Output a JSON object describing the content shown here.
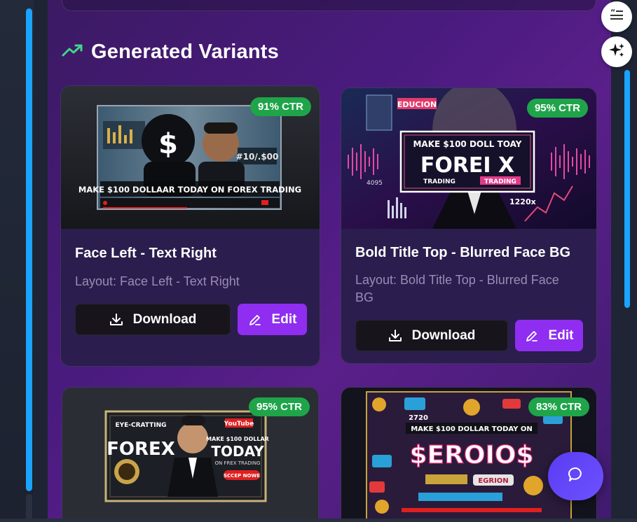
{
  "section": {
    "title": "Generated Variants",
    "icon": "trending-up-icon"
  },
  "cards": [
    {
      "ctr": "91% CTR",
      "title": "Face Left - Text Right",
      "layout": "Layout: Face Left - Text Right",
      "download_label": "Download",
      "edit_label": "Edit",
      "thumb_text": "MAKE $100 DOLLAAR TODAY ON FOREX TRADING",
      "thumb_small": "#10/.$00"
    },
    {
      "ctr": "95% CTR",
      "title": "Bold Title Top - Blurred Face BG",
      "layout_line1": "Layout: Bold Title Top - Blurred Face",
      "layout_line2": "BG",
      "download_label": "Download",
      "edit_label": "Edit",
      "thumb_badge": "EDUCION",
      "thumb_line1": "MAKE $100 DOLL TOAY",
      "thumb_main": "FOREI X",
      "thumb_sub": "TRADING",
      "thumb_sub2": "TRADING",
      "thumb_num1": "1220x",
      "thumb_num2": "4095"
    },
    {
      "ctr": "95% CTR",
      "thumb_top": "EYE-CRATTING",
      "thumb_yt": "YouTube",
      "thumb_forex": "FOREX",
      "thumb_make": "MAKE $100 DOLLAR",
      "thumb_today": "TODAY",
      "thumb_on": "ON FREX TRADING",
      "thumb_cta": "SCCEP NOWE"
    },
    {
      "ctr": "83% CTR",
      "thumb_line": "MAKE $100 DOLLAR TODAY ON",
      "thumb_main": "$EROIO$",
      "thumb_num": "2720",
      "thumb_tag": "EGRION"
    }
  ],
  "colors": {
    "accent_purple": "#8f2df0",
    "ctr_green": "#1fa44a",
    "scrollbar_blue": "#1aa3ff",
    "chat_fab": "#5b3cf2"
  },
  "floating": {
    "top_icon": "quote-list-icon",
    "second_icon": "sparkles-icon",
    "chat_icon": "chat-bubble-icon"
  }
}
